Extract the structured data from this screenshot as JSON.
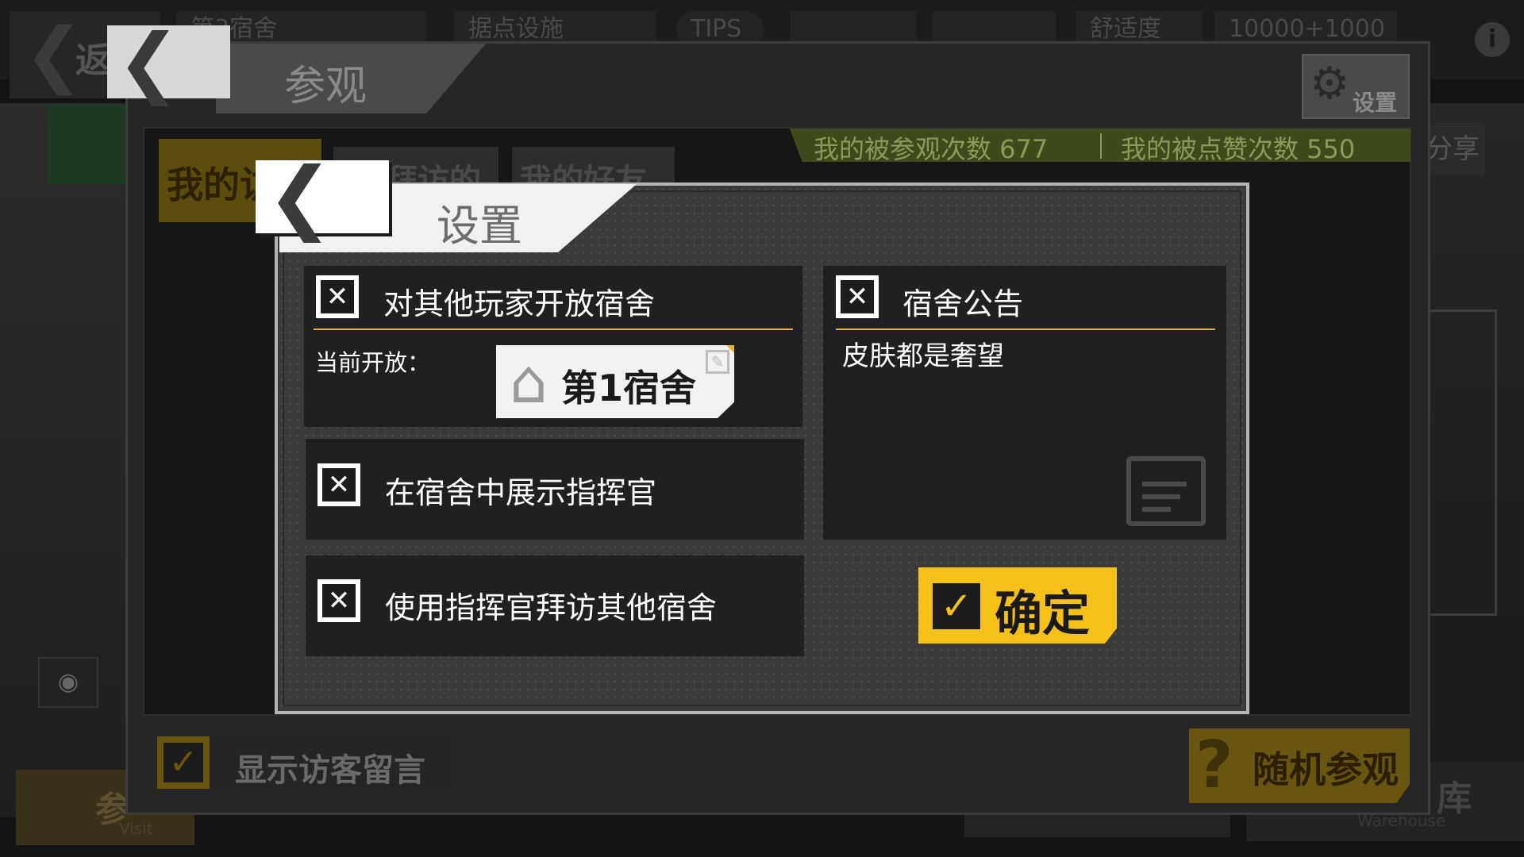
{
  "background": {
    "back_label": "返",
    "top_items": [
      "第3宿舍",
      "据点设施",
      "TIPS",
      "",
      "",
      "舒适度",
      "10000+1000"
    ],
    "share_label": "分享",
    "bottom_left": {
      "label": "参",
      "sub": "Visit"
    },
    "bottom_right": {
      "label": "库",
      "sub": "Warehouse"
    }
  },
  "visit_panel": {
    "title": "参观",
    "settings_label": "设置",
    "stats": {
      "visited_label": "我的被参观次数 677",
      "liked_label": "我的被点赞次数  550"
    },
    "tabs": [
      {
        "label": "我的访",
        "active": true
      },
      {
        "label": "拜访的",
        "active": false
      },
      {
        "label": "我的好友",
        "active": false
      }
    ],
    "show_visitor_messages": {
      "label": "显示访客留言",
      "checked": true,
      "check_glyph": "✓"
    },
    "random_visit_label": "随机参观"
  },
  "settings_dialog": {
    "title": "设置",
    "back_glyph": "❮",
    "options": {
      "open_dorm": {
        "label": "对其他玩家开放宿舍",
        "checked": false,
        "glyph": "✕"
      },
      "show_commander": {
        "label": "在宿舍中展示指挥官",
        "checked": false,
        "glyph": "✕"
      },
      "commander_visit": {
        "label": "使用指挥官拜访其他宿舍",
        "checked": false,
        "glyph": "✕"
      },
      "dorm_notice": {
        "label": "宿舍公告",
        "checked": false,
        "glyph": "✕"
      }
    },
    "current_open_label": "当前开放：",
    "current_dorm": "第1宿舍",
    "notice_text": "皮肤都是奢望",
    "confirm": {
      "label": "确定",
      "glyph": "✓"
    }
  },
  "colors": {
    "accent_yellow": "#f5c018",
    "underline_yellow": "#e5b52a",
    "stats_green": "#3f4a1c"
  },
  "icons": [
    "back-chevron-icon",
    "gear-icon",
    "info-icon",
    "eye-icon",
    "house-icon",
    "edit-icon",
    "notice-board-icon",
    "checkmark-icon",
    "close-x-icon",
    "question-icon"
  ]
}
